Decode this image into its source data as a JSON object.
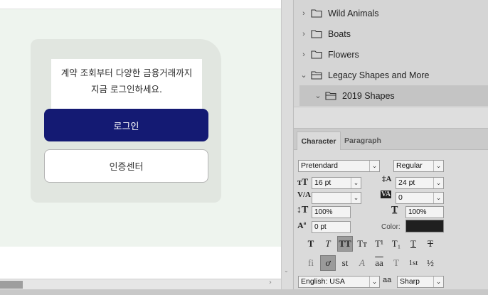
{
  "card": {
    "line1": "계약 조회부터 다양한 금융거래까지",
    "line2": "지금 로그인하세요.",
    "login_label": "로그인",
    "cert_label": "인증센터"
  },
  "shapes": {
    "items": [
      {
        "label": "Wild Animals",
        "expanded": false
      },
      {
        "label": "Boats",
        "expanded": false
      },
      {
        "label": "Flowers",
        "expanded": false
      },
      {
        "label": "Legacy Shapes and More",
        "expanded": true
      },
      {
        "label": "2019 Shapes",
        "expanded": true
      }
    ]
  },
  "character": {
    "tabs": [
      "Character",
      "Paragraph"
    ],
    "font_family": "Pretendard",
    "font_style": "Regular",
    "font_size": "16 pt",
    "leading": "24 pt",
    "kerning": "",
    "tracking": "0",
    "vertical_scale": "100%",
    "horizontal_scale": "100%",
    "baseline_shift": "0 pt",
    "color_label": "Color:",
    "color": "#1f1f1f",
    "type_buttons": [
      "T",
      "T",
      "TT",
      "Tт",
      "T¹",
      "T₁",
      "T",
      "T"
    ],
    "opentype_buttons": [
      "fi",
      "ơ",
      "st",
      "A",
      "aa",
      "T",
      "1st",
      "½"
    ],
    "language": "English: USA",
    "aa_label": "aa",
    "antialias": "Sharp"
  }
}
